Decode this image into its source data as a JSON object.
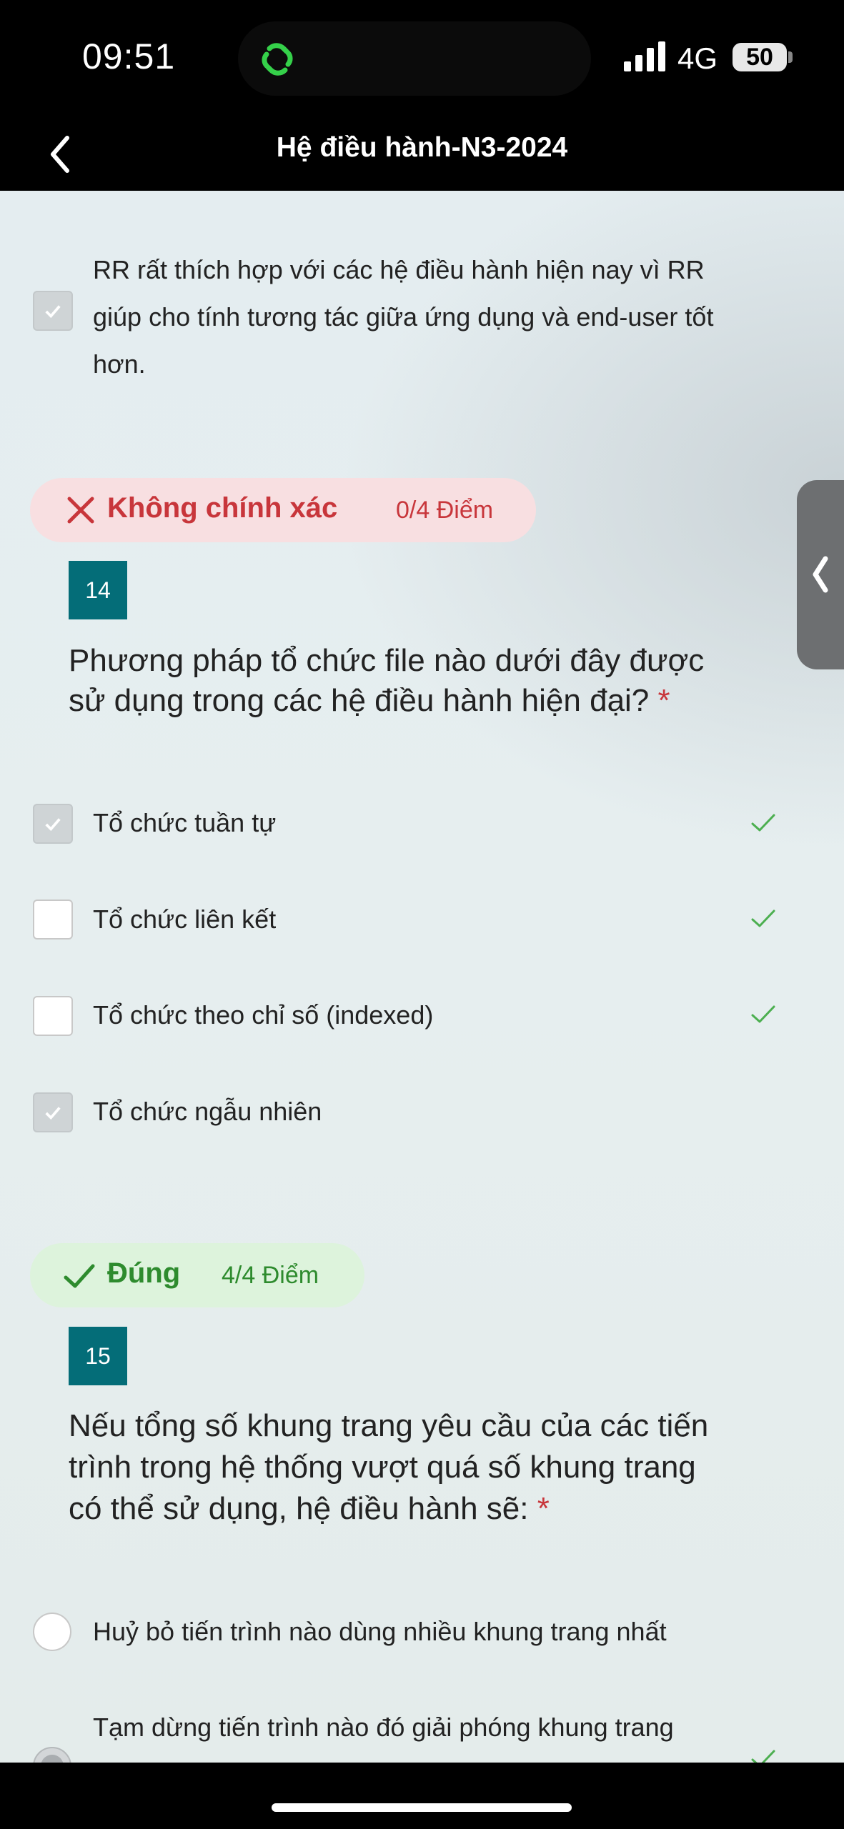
{
  "status_bar": {
    "time": "09:51",
    "network": "4G",
    "battery": "50"
  },
  "header": {
    "title": "Hệ điều hành-N3-2024"
  },
  "prev_option": {
    "text_line1": "RR rất thích hợp với các hệ điều hành hiện nay vì RR",
    "text_line2": "giúp cho tính tương tác giữa ứng dụng và end-user tốt",
    "text_line3": "hơn.",
    "checked": true
  },
  "q14": {
    "status": "Không chính xác",
    "score": "0/4 Điểm",
    "number": "14",
    "question_line1": "Phương pháp tổ chức file nào dưới đây được",
    "question_line2": "sử dụng trong các hệ điều hành hiện đại?",
    "required_mark": "*",
    "options": [
      {
        "label": "Tổ chức tuần tự",
        "checked": true,
        "correct": true
      },
      {
        "label": "Tổ chức liên kết",
        "checked": false,
        "correct": true
      },
      {
        "label": "Tổ chức theo chỉ số (indexed)",
        "checked": false,
        "correct": true
      },
      {
        "label": "Tổ chức ngẫu nhiên",
        "checked": true,
        "correct": false
      }
    ]
  },
  "q15": {
    "status": "Đúng",
    "score": "4/4 Điểm",
    "number": "15",
    "question_line1": "Nếu tổng số khung trang yêu cầu của các tiến",
    "question_line2": "trình trong hệ thống vượt quá số khung trang",
    "question_line3": "có thể sử dụng, hệ điều hành sẽ:",
    "required_mark": "*",
    "options": [
      {
        "label": "Huỷ bỏ tiến trình nào dùng nhiều khung trang nhất",
        "selected": false,
        "correct": false
      },
      {
        "label": "Tạm dừng tiến trình nào đó giải phóng khung trang",
        "selected": true,
        "correct": true
      }
    ]
  },
  "colors": {
    "teal": "#046d78",
    "wrong_red": "#c8363b",
    "right_green": "#2e8b2e",
    "check_green": "#4caf50"
  }
}
